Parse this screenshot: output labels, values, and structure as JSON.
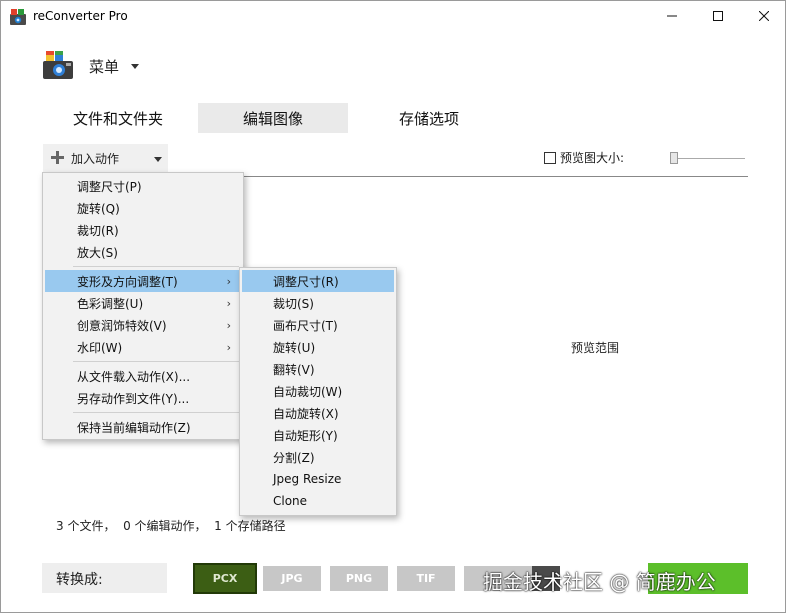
{
  "window": {
    "title": "reConverter Pro"
  },
  "header": {
    "menu_label": "菜单"
  },
  "tabs": [
    {
      "label": "文件和文件夹"
    },
    {
      "label": "编辑图像"
    },
    {
      "label": "存储选项"
    }
  ],
  "toolbar": {
    "add_action_label": "加入动作",
    "preview_size_label": "预览图大小:",
    "preview_size_checked": false
  },
  "preview": {
    "area_label": "预览范围"
  },
  "main_menu": {
    "items": [
      {
        "label": "调整尺寸(P)"
      },
      {
        "label": "旋转(Q)"
      },
      {
        "label": "裁切(R)"
      },
      {
        "label": "放大(S)"
      },
      {
        "label": "变形及方向调整(T)"
      },
      {
        "label": "色彩调整(U)"
      },
      {
        "label": "创意润饰特效(V)"
      },
      {
        "label": "水印(W)"
      },
      {
        "label": "从文件载入动作(X)..."
      },
      {
        "label": "另存动作到文件(Y)..."
      },
      {
        "label": "保持当前编辑动作(Z)"
      }
    ]
  },
  "sub_menu": {
    "items": [
      {
        "label": "调整尺寸(R)"
      },
      {
        "label": "裁切(S)"
      },
      {
        "label": "画布尺寸(T)"
      },
      {
        "label": "旋转(U)"
      },
      {
        "label": "翻转(V)"
      },
      {
        "label": "自动裁切(W)"
      },
      {
        "label": "自动旋转(X)"
      },
      {
        "label": "自动矩形(Y)"
      },
      {
        "label": "分割(Z)"
      },
      {
        "label": "Jpeg Resize"
      },
      {
        "label": "Clone"
      }
    ]
  },
  "status": {
    "text": "3 个文件，  0 个编辑动作，  1 个存储路径"
  },
  "bottom": {
    "convert_label": "转换成:",
    "formats": [
      "PCX",
      "JPG",
      "PNG",
      "TIF"
    ],
    "selected_format": "PCX"
  },
  "watermark": {
    "text": "掘金技术社区 @ 简鹿办公"
  },
  "colors": {
    "highlight": "#99c9ef",
    "pcx_bg": "#3c5e14",
    "start_green": "#5cbf2a"
  }
}
